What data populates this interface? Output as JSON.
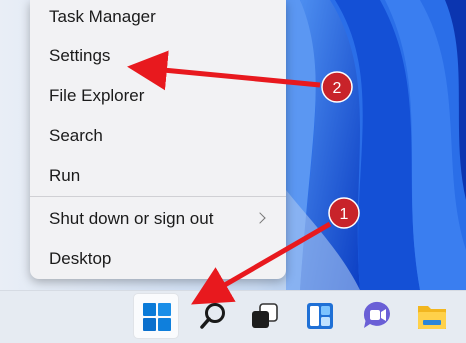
{
  "menu": {
    "items": [
      {
        "label": "Task Manager"
      },
      {
        "label": "Settings"
      },
      {
        "label": "File Explorer"
      },
      {
        "label": "Search"
      },
      {
        "label": "Run"
      },
      {
        "label": "Shut down or sign out",
        "has_submenu": true
      },
      {
        "label": "Desktop"
      }
    ]
  },
  "annotations": {
    "step1": "1",
    "step2": "2",
    "arrow_color": "#e8191e",
    "badge_color": "#c8232a"
  },
  "taskbar": {
    "icons": [
      "windows-start-icon",
      "search-icon",
      "task-view-icon",
      "widgets-icon",
      "teams-chat-icon",
      "file-explorer-icon"
    ]
  },
  "colors": {
    "menu_bg": "#f2f2f4",
    "taskbar_bg": "#e6ebf2",
    "wallpaper_blue": "#1a5ee0",
    "accent": "#0a7ad8"
  }
}
